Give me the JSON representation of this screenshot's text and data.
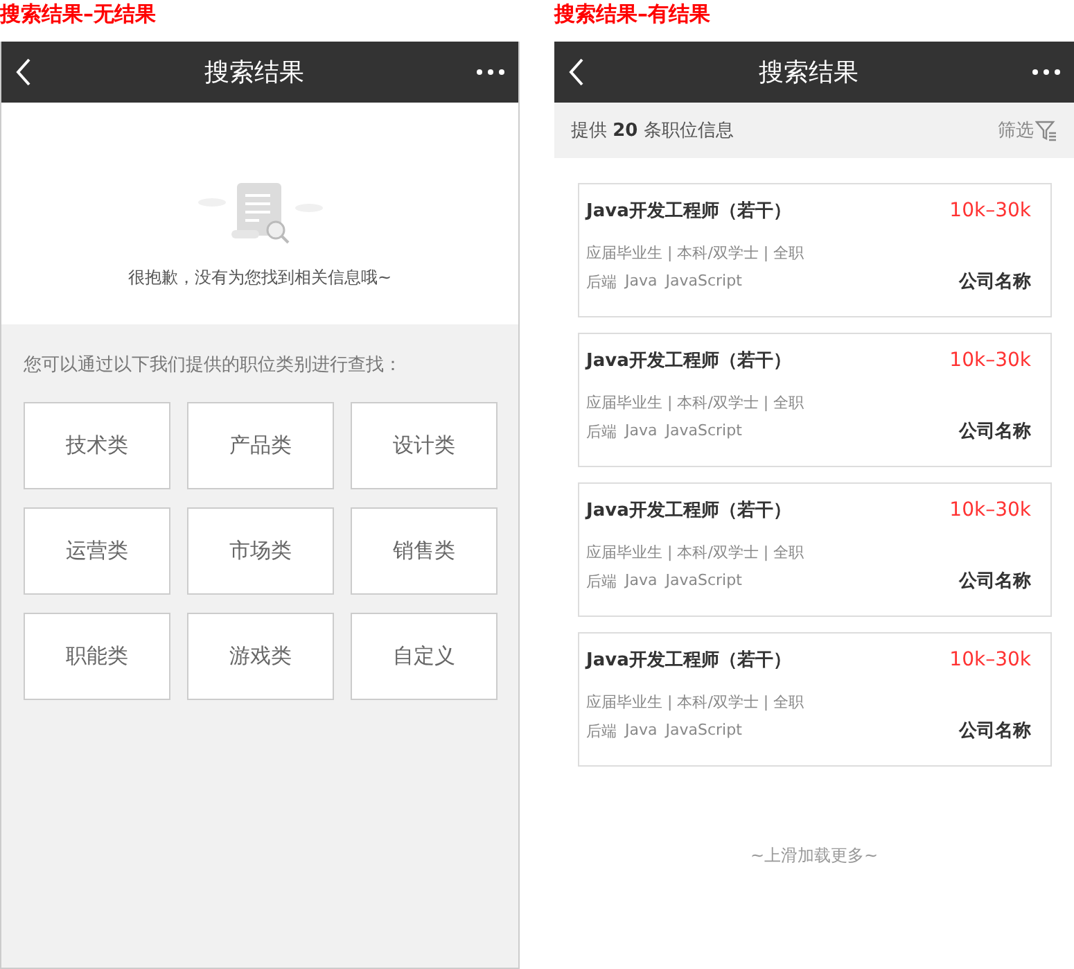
{
  "screens": [
    {
      "kind": "empty",
      "caption": "搜索结果–无结果",
      "title": "搜索结果",
      "message": "很抱歉，没有为您找到相关信息哦~",
      "hint": "您可以通过以下我们提供的职位类别进行查找：",
      "categories": [
        "技术类",
        "产品类",
        "设计类",
        "运营类",
        "市场类",
        "销售类",
        "职能类",
        "游戏类",
        "自定义"
      ]
    },
    {
      "kind": "results",
      "caption": "搜索结果–有结果",
      "title": "搜索结果",
      "summary": "提供 **20** 条职位信息",
      "filter": "筛选",
      "jobs": [
        {
          "title": "Java开发工程师（若干）",
          "salary": "10k–30k",
          "meta": "应届毕业生 | 本科/双学士 | 全职",
          "tags": [
            "后端",
            "Java",
            "JavaScript"
          ],
          "company": "公司名称"
        },
        {
          "title": "Java开发工程师（若干）",
          "salary": "10k–30k",
          "meta": "应届毕业生 | 本科/双学士 | 全职",
          "tags": [
            "后端",
            "Java",
            "JavaScript"
          ],
          "company": "公司名称"
        },
        {
          "title": "Java开发工程师（若干）",
          "salary": "10k–30k",
          "meta": "应届毕业生 | 本科/双学士 | 全职",
          "tags": [
            "后端",
            "Java",
            "JavaScript"
          ],
          "company": "公司名称"
        },
        {
          "title": "Java开发工程师（若干）",
          "salary": "10k–30k",
          "meta": "应届毕业生 | 本科/双学士 | 全职",
          "tags": [
            "后端",
            "Java",
            "JavaScript"
          ],
          "company": "公司名称"
        }
      ],
      "load_more": "~上滑加载更多~"
    }
  ]
}
